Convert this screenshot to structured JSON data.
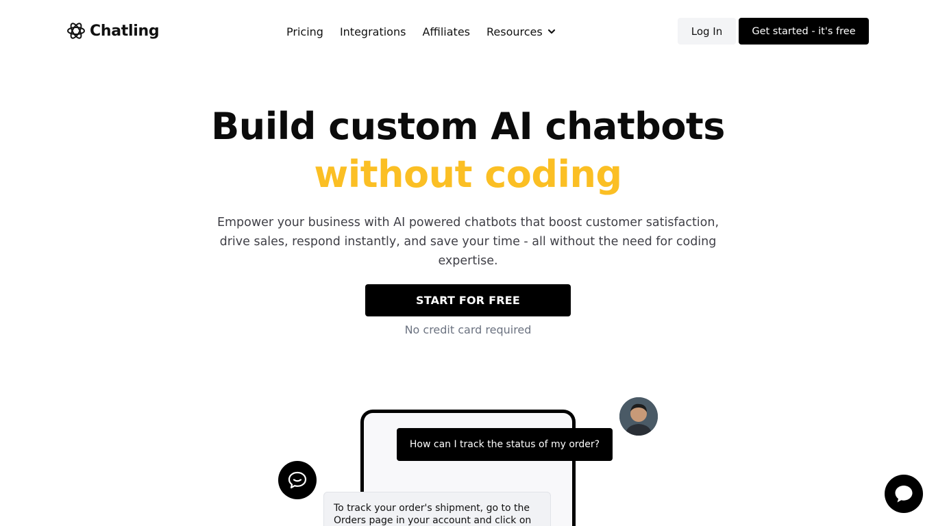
{
  "brand": {
    "name": "Chatling"
  },
  "nav": {
    "items": [
      {
        "label": "Pricing"
      },
      {
        "label": "Integrations"
      },
      {
        "label": "Affiliates"
      },
      {
        "label": "Resources"
      }
    ],
    "login_label": "Log In",
    "cta_label": "Get started - it's free"
  },
  "hero": {
    "title_line1": "Build custom AI chatbots",
    "title_line2": "without coding",
    "subtitle": "Empower your business with AI powered chatbots that boost customer satisfaction, drive sales, respond instantly, and save your time - all without the need for coding expertise.",
    "start_label": "START FOR FREE",
    "note": "No credit card required"
  },
  "demo": {
    "question": "How can I track the status of my order?",
    "answer": "To track your order's shipment, go to the Orders page in your account and click on"
  },
  "colors": {
    "accent": "#fbbf24",
    "primary": "#000000"
  },
  "icons": {
    "logo": "atom-icon",
    "resources_caret": "chevron-down-icon",
    "bot": "chat-bubble-icon",
    "launcher": "chat-bubble-icon"
  }
}
